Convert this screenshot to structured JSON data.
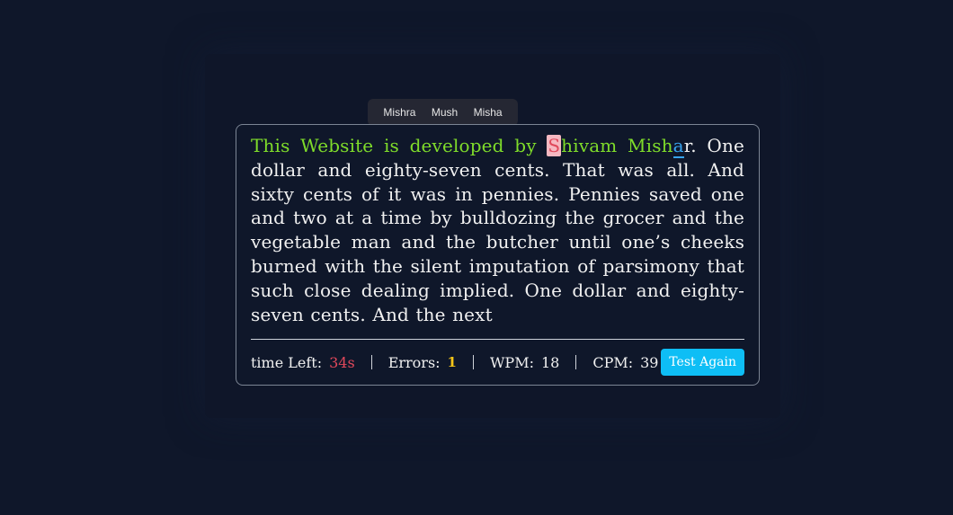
{
  "suggestions": [
    "Mishra",
    "Mush",
    "Misha"
  ],
  "passage": {
    "typed": "This Website is developed by ",
    "error_char": "S",
    "typed_after_error": "hivam Mish",
    "cursor_char": "a",
    "remaining": "r. One dollar and eighty-seven cents. That was all. And sixty cents of it was in pennies. Pennies saved one and two at a time by bulldozing the grocer and the vegetable man and the butcher until one’s cheeks burned with the silent imputation of parsimony that such close dealing implied. One dollar and eighty-seven cents. And the next"
  },
  "stats": {
    "time_label": "time Left:",
    "time_value": "34s",
    "errors_label": "Errors:",
    "errors_value": "1",
    "wpm_label": "WPM:",
    "wpm_value": "18",
    "cpm_label": "CPM:",
    "cpm_value": "39"
  },
  "retry_label": "Test Again",
  "colors": {
    "background": "#0f172a",
    "typed": "#7fdc2a",
    "error": "#e0485b",
    "cursor": "#38a4f0",
    "accent_button": "#0ebef5",
    "errors_count": "#f5c518"
  }
}
